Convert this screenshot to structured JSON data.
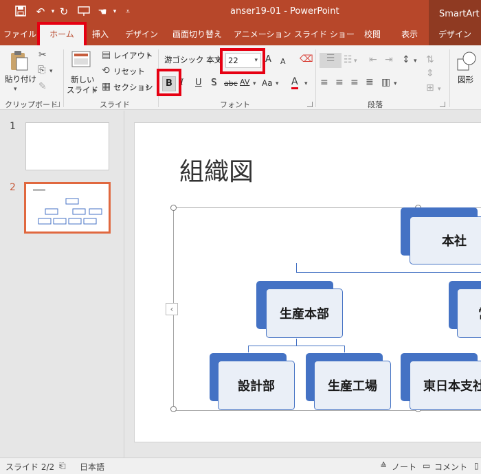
{
  "window": {
    "title": "anser19-01  -  PowerPoint",
    "contextual_header": "SmartArt ツ"
  },
  "quick_access": {
    "save_icon": "save-icon",
    "undo_icon": "undo-icon",
    "redo_icon": "repeat-icon",
    "present_icon": "start-from-beginning-icon",
    "touch_icon": "touch-mode-icon",
    "customize_icon": "customize-qat-icon"
  },
  "tabs": [
    {
      "label": "ファイル"
    },
    {
      "label": "ホーム",
      "active": true
    },
    {
      "label": "挿入"
    },
    {
      "label": "デザイン"
    },
    {
      "label": "画面切り替え"
    },
    {
      "label": "アニメーション"
    },
    {
      "label": "スライド ショー"
    },
    {
      "label": "校閲"
    },
    {
      "label": "表示"
    },
    {
      "label": "デザイン",
      "contextual": true
    }
  ],
  "ribbon": {
    "clipboard": {
      "paste_label": "貼り付け",
      "group_label": "クリップボード"
    },
    "slides": {
      "new_slide_label": "新しい\nスライド",
      "new_slide_line1": "新しい",
      "new_slide_line2": "スライド",
      "layout_label": "レイアウト",
      "reset_label": "リセット",
      "section_label": "セクション",
      "group_label": "スライド"
    },
    "font": {
      "font_name": "游ゴシック 本文",
      "font_size": "22",
      "bold_label": "B",
      "italic_label": "I",
      "underline_label": "U",
      "shadow_label": "S",
      "strike_label": "abc",
      "spacing_label": "AV",
      "case_label": "Aa",
      "grow_label": "A",
      "shrink_label": "A",
      "color_label": "A",
      "group_label": "フォント"
    },
    "paragraph": {
      "group_label": "段落"
    },
    "drawing": {
      "shape_label": "図形"
    }
  },
  "slides_pane": {
    "slides": [
      {
        "number": "1"
      },
      {
        "number": "2",
        "selected": true
      }
    ]
  },
  "slide": {
    "title": "組織図",
    "org_chart": {
      "top": "本社",
      "level2_left": "生産本部",
      "level2_right": "営",
      "level3": [
        "設計部",
        "生産工場",
        "東日本支社"
      ]
    },
    "text_pane_toggle": "‹"
  },
  "status": {
    "slide_info": "スライド 2/2",
    "language": "日本語",
    "notes_label": "ノート",
    "comments_label": "コメント"
  },
  "colors": {
    "accent": "#b7472a",
    "highlight": "#e60012",
    "node_blue": "#4472c4",
    "node_fill": "#eaeff7"
  }
}
